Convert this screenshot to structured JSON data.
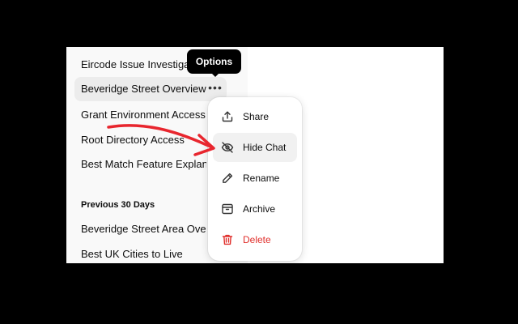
{
  "sidebar": {
    "items": [
      {
        "label": "Eircode Issue Investigation"
      },
      {
        "label": "Beveridge Street Overview"
      },
      {
        "label": "Grant Environment Access"
      },
      {
        "label": "Root Directory Access"
      },
      {
        "label": "Best Match Feature Explanation"
      }
    ],
    "section_header": "Previous 30 Days",
    "previous_items": [
      {
        "label": "Beveridge Street Area Overview"
      },
      {
        "label": "Best UK Cities to Live"
      }
    ],
    "active_index": 1
  },
  "tooltip": {
    "text": "Options"
  },
  "menu": {
    "items": [
      {
        "label": "Share",
        "icon": "share-icon"
      },
      {
        "label": "Hide Chat",
        "icon": "eye-off-icon"
      },
      {
        "label": "Rename",
        "icon": "pencil-icon"
      },
      {
        "label": "Archive",
        "icon": "archive-icon"
      },
      {
        "label": "Delete",
        "icon": "trash-icon"
      }
    ]
  },
  "colors": {
    "annotation_arrow": "#e8262e",
    "delete": "#e02e2a",
    "sidebar_bg": "#f9f9f9",
    "active_item_bg": "#ececec"
  }
}
